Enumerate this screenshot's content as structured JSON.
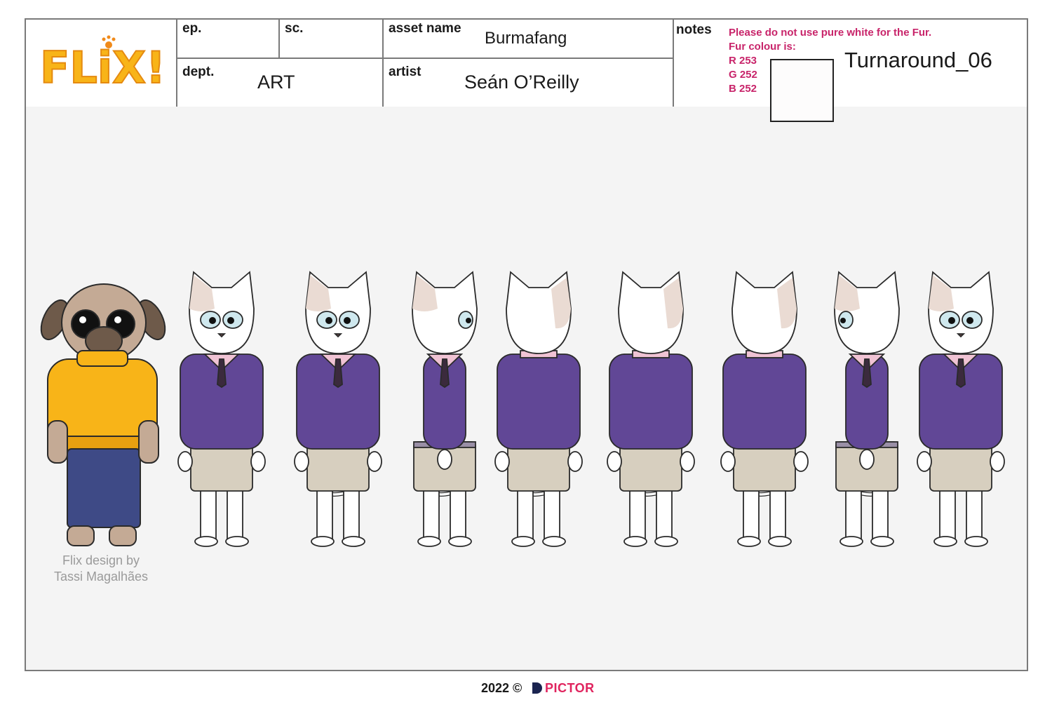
{
  "header": {
    "ep_label": "ep.",
    "sc_label": "sc.",
    "asset_label": "asset name",
    "asset_value": "Burmafang",
    "dept_label": "dept.",
    "dept_value": "ART",
    "artist_label": "artist",
    "artist_value": "Seán O’Reilly",
    "notes_label": "notes"
  },
  "logo": {
    "text": "FLiX!"
  },
  "notes": {
    "line1": "Please do not use pure white for the Fur.",
    "line2": "Fur colour is:",
    "r": "R 253",
    "g": "G 252",
    "b": "B 252",
    "swatch_color": "#fdfcfc",
    "turnaround": "Turnaround_06"
  },
  "credit": {
    "line1": "Flix design by",
    "line2": "Tassi Magalhães"
  },
  "footer": {
    "year": "2022 ©",
    "brand": "PICTOR"
  },
  "colors": {
    "note_text": "#c8246a",
    "sweater_purple": "#614796",
    "shorts_khaki": "#d7cfbf",
    "collar_pink": "#f0c3d4",
    "fur_patch": "#eadbd3",
    "pug_sweater": "#f8b418",
    "pug_jeans": "#3e4a86",
    "pug_fur": "#c4aa95"
  }
}
